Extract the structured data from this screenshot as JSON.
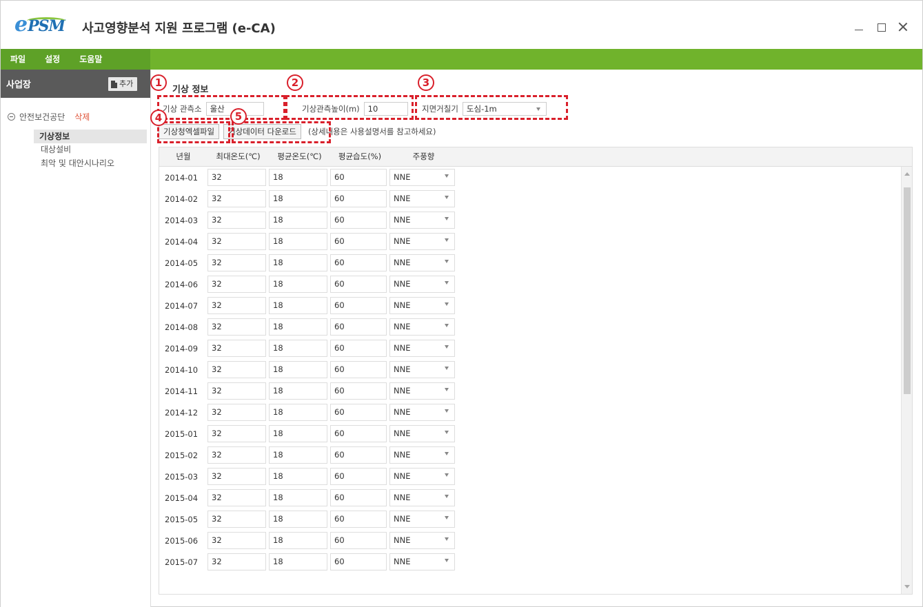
{
  "app": {
    "logo_e": "e",
    "logo_psm": "PSM",
    "title": "사고영향분석 지원 프로그램 (e-CA)"
  },
  "menu": [
    "파일",
    "설정",
    "도움말"
  ],
  "sidebar": {
    "header": "사업장",
    "add_label": "추가",
    "root_label": "안전보건공단",
    "delete_label": "삭제",
    "children": [
      "기상정보",
      "대상설비",
      "최악 및 대안시나리오"
    ]
  },
  "weather": {
    "section_title": "기상 정보",
    "station_label": "기상 관측소",
    "station_value": "울산",
    "height_label": "기상관측높이(m)",
    "height_value": "10",
    "roughness_label": "지면거칠기",
    "roughness_value": "도심-1m",
    "excel_button": "기상청엑셀파일",
    "download_button": "기상데이터 다운로드",
    "hint": "(상세내용은 사용설명서를 참고하세요)"
  },
  "callouts": [
    "1",
    "2",
    "3",
    "4",
    "5"
  ],
  "accent_color": "#d9202b",
  "menu_color": "#70b32c",
  "table": {
    "headers": [
      "년월",
      "최대온도(℃)",
      "평균온도(℃)",
      "평균습도(%)",
      "주풍향"
    ],
    "rows": [
      {
        "ym": "2014-01",
        "max": "32",
        "avg": "18",
        "hum": "60",
        "wind": "NNE"
      },
      {
        "ym": "2014-02",
        "max": "32",
        "avg": "18",
        "hum": "60",
        "wind": "NNE"
      },
      {
        "ym": "2014-03",
        "max": "32",
        "avg": "18",
        "hum": "60",
        "wind": "NNE"
      },
      {
        "ym": "2014-04",
        "max": "32",
        "avg": "18",
        "hum": "60",
        "wind": "NNE"
      },
      {
        "ym": "2014-05",
        "max": "32",
        "avg": "18",
        "hum": "60",
        "wind": "NNE"
      },
      {
        "ym": "2014-06",
        "max": "32",
        "avg": "18",
        "hum": "60",
        "wind": "NNE"
      },
      {
        "ym": "2014-07",
        "max": "32",
        "avg": "18",
        "hum": "60",
        "wind": "NNE"
      },
      {
        "ym": "2014-08",
        "max": "32",
        "avg": "18",
        "hum": "60",
        "wind": "NNE"
      },
      {
        "ym": "2014-09",
        "max": "32",
        "avg": "18",
        "hum": "60",
        "wind": "NNE"
      },
      {
        "ym": "2014-10",
        "max": "32",
        "avg": "18",
        "hum": "60",
        "wind": "NNE"
      },
      {
        "ym": "2014-11",
        "max": "32",
        "avg": "18",
        "hum": "60",
        "wind": "NNE"
      },
      {
        "ym": "2014-12",
        "max": "32",
        "avg": "18",
        "hum": "60",
        "wind": "NNE"
      },
      {
        "ym": "2015-01",
        "max": "32",
        "avg": "18",
        "hum": "60",
        "wind": "NNE"
      },
      {
        "ym": "2015-02",
        "max": "32",
        "avg": "18",
        "hum": "60",
        "wind": "NNE"
      },
      {
        "ym": "2015-03",
        "max": "32",
        "avg": "18",
        "hum": "60",
        "wind": "NNE"
      },
      {
        "ym": "2015-04",
        "max": "32",
        "avg": "18",
        "hum": "60",
        "wind": "NNE"
      },
      {
        "ym": "2015-05",
        "max": "32",
        "avg": "18",
        "hum": "60",
        "wind": "NNE"
      },
      {
        "ym": "2015-06",
        "max": "32",
        "avg": "18",
        "hum": "60",
        "wind": "NNE"
      },
      {
        "ym": "2015-07",
        "max": "32",
        "avg": "18",
        "hum": "60",
        "wind": "NNE"
      }
    ]
  }
}
